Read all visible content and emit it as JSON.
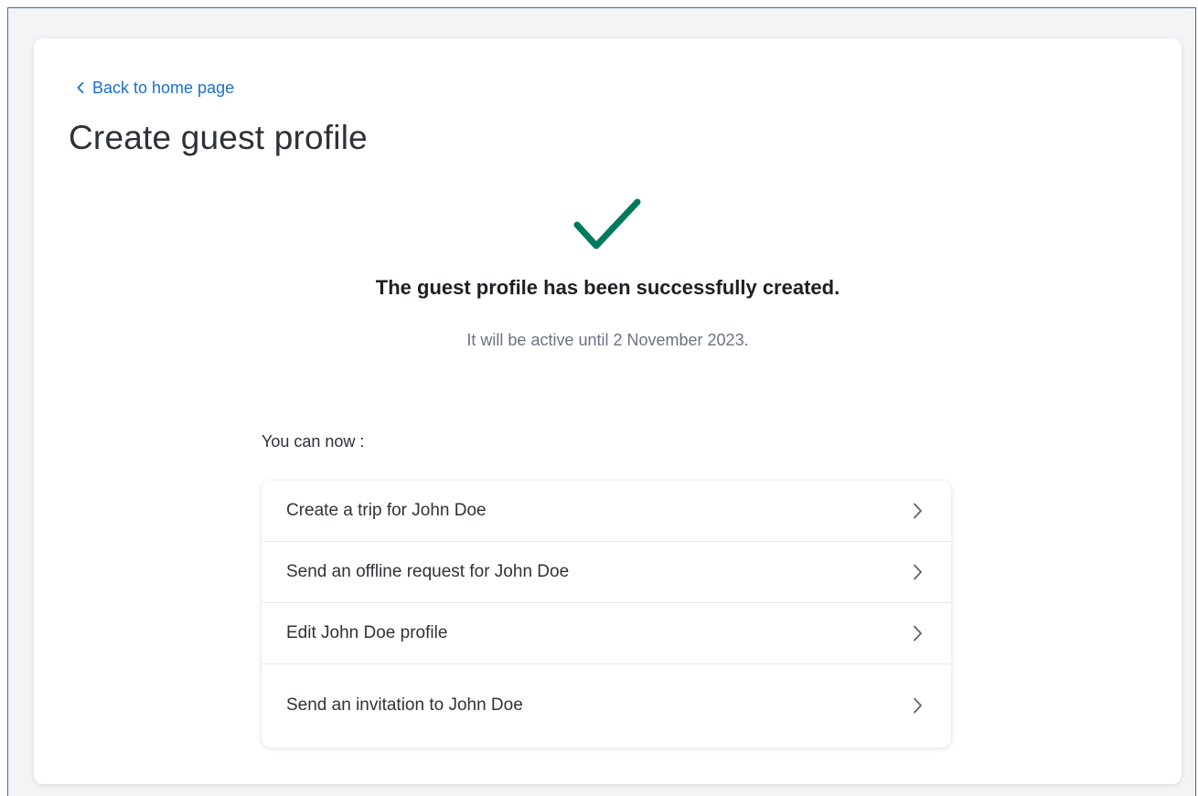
{
  "nav": {
    "back_label": "Back to home page"
  },
  "page": {
    "title": "Create guest profile"
  },
  "confirmation": {
    "title": "The guest profile has been successfully created.",
    "subtitle": "It will be active until 2 November 2023."
  },
  "next_steps": {
    "label": "You can now :",
    "items": [
      {
        "label": "Create a trip for John Doe"
      },
      {
        "label": "Send an offline request for John Doe"
      },
      {
        "label": "Edit John Doe profile"
      },
      {
        "label": "Send an invitation to John Doe"
      }
    ]
  },
  "icons": {
    "back": "chevron-left-icon",
    "success": "checkmark-icon",
    "row_arrow": "chevron-right-icon"
  },
  "colors": {
    "accent": "#1B6FD1",
    "success": "#007A5E",
    "frame": "#2F6FB8"
  }
}
